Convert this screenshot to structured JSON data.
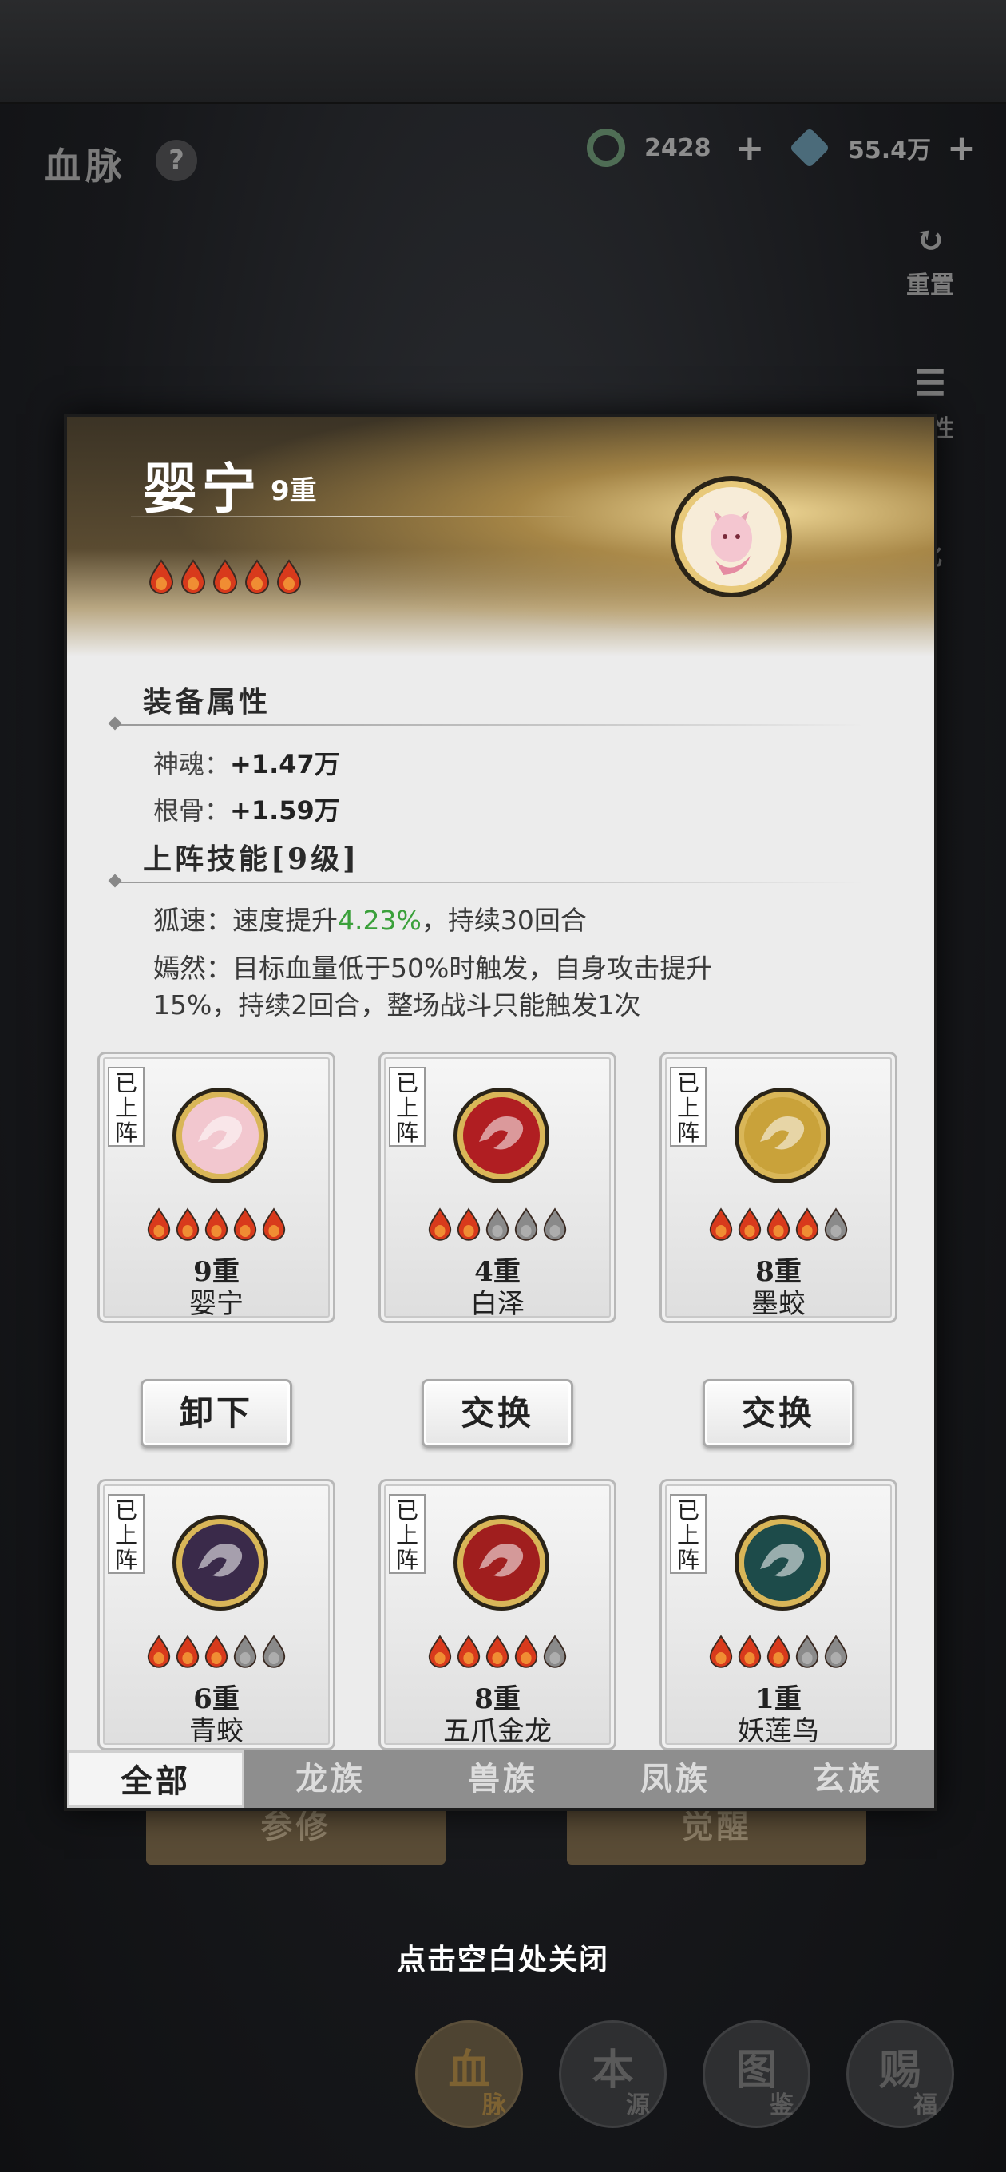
{
  "header": {
    "title": "血脉",
    "help_label": "?",
    "currency_jade": "2428",
    "currency_crystal": "55.4万",
    "plus": "+"
  },
  "side": {
    "reset": "重置",
    "attr_partial": "属性",
    "evolve_partial": "化"
  },
  "modal": {
    "hero_name": "婴宁",
    "hero_level": "9重",
    "hero_drops_filled": 5,
    "equip_section": "装备属性",
    "attrs": [
      {
        "label": "神魂：",
        "value": "+1.47万"
      },
      {
        "label": "根骨：",
        "value": "+1.59万"
      }
    ],
    "skill_section": "上阵技能[9级]",
    "skill1_prefix": "狐速：速度提升",
    "skill1_highlight": "4.23%",
    "skill1_suffix": "，持续30回合",
    "skill2_line1": "嫣然：目标血量低于50%时触发，自身攻击提升",
    "skill2_line2": "15%，持续2回合，整场战斗只能触发1次",
    "badge_text": "已上阵",
    "cards": [
      {
        "level": "9重",
        "name": "婴宁",
        "filled": 5,
        "avatar": "fox-avatar-icon",
        "color": "#f2c7cf"
      },
      {
        "level": "4重",
        "name": "白泽",
        "filled": 2,
        "avatar": "white-dragon-avatar-icon",
        "color": "#b01e22"
      },
      {
        "level": "8重",
        "name": "墨蛟",
        "filled": 4,
        "avatar": "black-dragon-avatar-icon",
        "color": "#c9a23a"
      },
      {
        "level": "6重",
        "name": "青蛟",
        "filled": 3,
        "avatar": "purple-dragon-avatar-icon",
        "color": "#3a2a4a"
      },
      {
        "level": "8重",
        "name": "五爪金龙",
        "filled": 4,
        "avatar": "golden-dragon-avatar-icon",
        "color": "#a01e1e"
      },
      {
        "level": "1重",
        "name": "妖莲鸟",
        "filled": 3,
        "avatar": "cyan-serpent-avatar-icon",
        "color": "#1d4b4a"
      }
    ],
    "buttons": [
      "卸下",
      "交换",
      "交换"
    ],
    "tabs": [
      "全部",
      "龙族",
      "兽族",
      "凤族",
      "玄族"
    ]
  },
  "background_buttons": [
    "参修",
    "觉醒"
  ],
  "close_hint": "点击空白处关闭",
  "bottom_nav": [
    {
      "main": "血",
      "sub": "脉"
    },
    {
      "main": "本",
      "sub": "源"
    },
    {
      "main": "图",
      "sub": "鉴"
    },
    {
      "main": "赐",
      "sub": "福"
    }
  ],
  "colors": {
    "drop_filled": "#d83a1c",
    "drop_empty": "#8a8a8a",
    "highlight": "#3aa03a"
  }
}
